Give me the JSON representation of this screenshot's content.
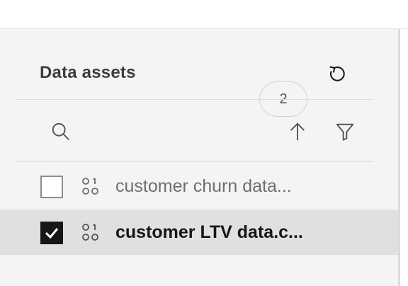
{
  "panel": {
    "title": "Data assets",
    "count": "2"
  },
  "toolbar": {
    "search_icon": "search-icon",
    "sort_icon": "arrow-up-icon",
    "filter_icon": "filter-icon",
    "refresh_icon": "refresh-icon"
  },
  "assets": [
    {
      "name": "customer churn data...",
      "checked": false,
      "icon": "data-asset-icon"
    },
    {
      "name": "customer LTV data.c...",
      "checked": true,
      "icon": "data-asset-icon"
    }
  ],
  "colors": {
    "panel_bg": "#f4f4f4",
    "selected_row_bg": "#e0e0e0",
    "checkbox_checked": "#161616"
  }
}
